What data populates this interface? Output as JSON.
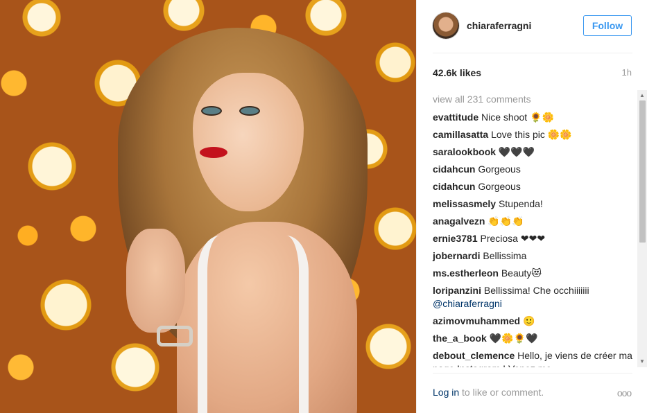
{
  "post": {
    "username": "chiaraferragni",
    "follow_label": "Follow",
    "likes": "42.6k likes",
    "time": "1h",
    "view_all": "view all 231 comments",
    "comments": [
      {
        "author": "evattitude",
        "text": "Nice shoot 🌻🌼"
      },
      {
        "author": "camillasatta",
        "text": "Love this pic 🌼🌼"
      },
      {
        "author": "saralookbook",
        "text": "🖤🖤🖤"
      },
      {
        "author": "cidahcun",
        "text": "Gorgeous"
      },
      {
        "author": "cidahcun",
        "text": "Gorgeous"
      },
      {
        "author": "melissasmely",
        "text": "Stupenda!"
      },
      {
        "author": "anagalvezn",
        "text": "👏👏👏"
      },
      {
        "author": "ernie3781",
        "text": "Preciosa ❤❤❤"
      },
      {
        "author": "jobernardi",
        "text": "Bellissima"
      },
      {
        "author": "ms.estherleon",
        "text": "Beauty😻"
      },
      {
        "author": "loripanzini",
        "text": "Bellissima! Che occhiiiiiii",
        "mention": "@chiaraferragni"
      },
      {
        "author": "azimovmuhammed",
        "text": "🙂"
      },
      {
        "author": "the_a_book",
        "text": "🖤🌼🌻🖤"
      },
      {
        "author": "debout_clemence",
        "text": "Hello, je viens de créer ma page Instagram ! Venez me"
      }
    ],
    "footer": {
      "login": "Log in",
      "rest": " to like or comment.",
      "more": "ooo"
    }
  },
  "icons": {
    "avatar": "profile-avatar",
    "more": "more-options-icon"
  },
  "colors": {
    "accent": "#3897f0",
    "link": "#003569",
    "muted": "#999999"
  }
}
